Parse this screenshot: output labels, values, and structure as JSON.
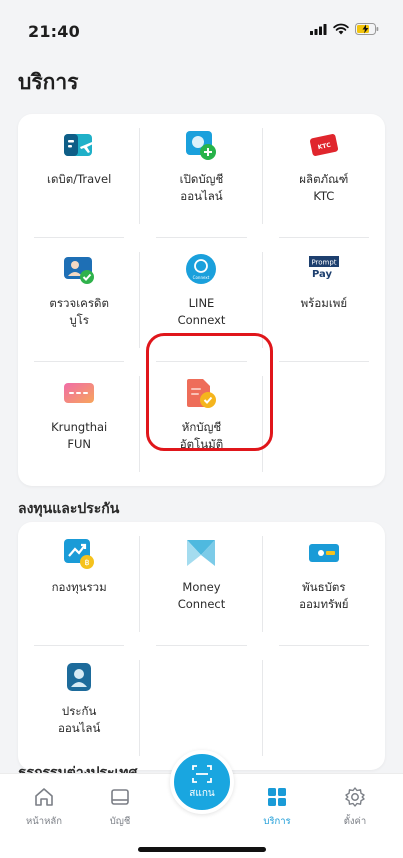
{
  "status": {
    "time": "21:40"
  },
  "page": {
    "title": "บริการ"
  },
  "services": {
    "items": [
      {
        "label": "เดบิต/Travel"
      },
      {
        "label": "เปิดบัญชี\nออนไลน์"
      },
      {
        "label": "ผลิตภัณฑ์\nKTC"
      },
      {
        "label": "ตรวจเครดิต\nบูโร"
      },
      {
        "label": "LINE\nConnext"
      },
      {
        "label": "พร้อมเพย์"
      },
      {
        "label": "Krungthai\nFUN"
      },
      {
        "label": "หักบัญชี\nอัตโนมัติ"
      }
    ],
    "icons": {
      "ktc_text": "KTC",
      "promptpay_top": "Prompt",
      "promptpay_bottom": "Pay",
      "connext_text": "Connext"
    }
  },
  "invest": {
    "title": "ลงทุนและประกัน",
    "items": [
      {
        "label": "กองทุนรวม"
      },
      {
        "label": "Money\nConnect"
      },
      {
        "label": "พันธบัตร\nออมทรัพย์"
      },
      {
        "label": "ประกัน\nออนไลน์"
      }
    ]
  },
  "foreign": {
    "title": "ธุรกรรมต่างประเทศ"
  },
  "nav": {
    "home": "หน้าหลัก",
    "account": "บัญชี",
    "scan": "สแกน",
    "services": "บริการ",
    "settings": "ตั้งค่า"
  },
  "colors": {
    "accent": "#1a9bd7",
    "highlight": "#e0161b"
  }
}
